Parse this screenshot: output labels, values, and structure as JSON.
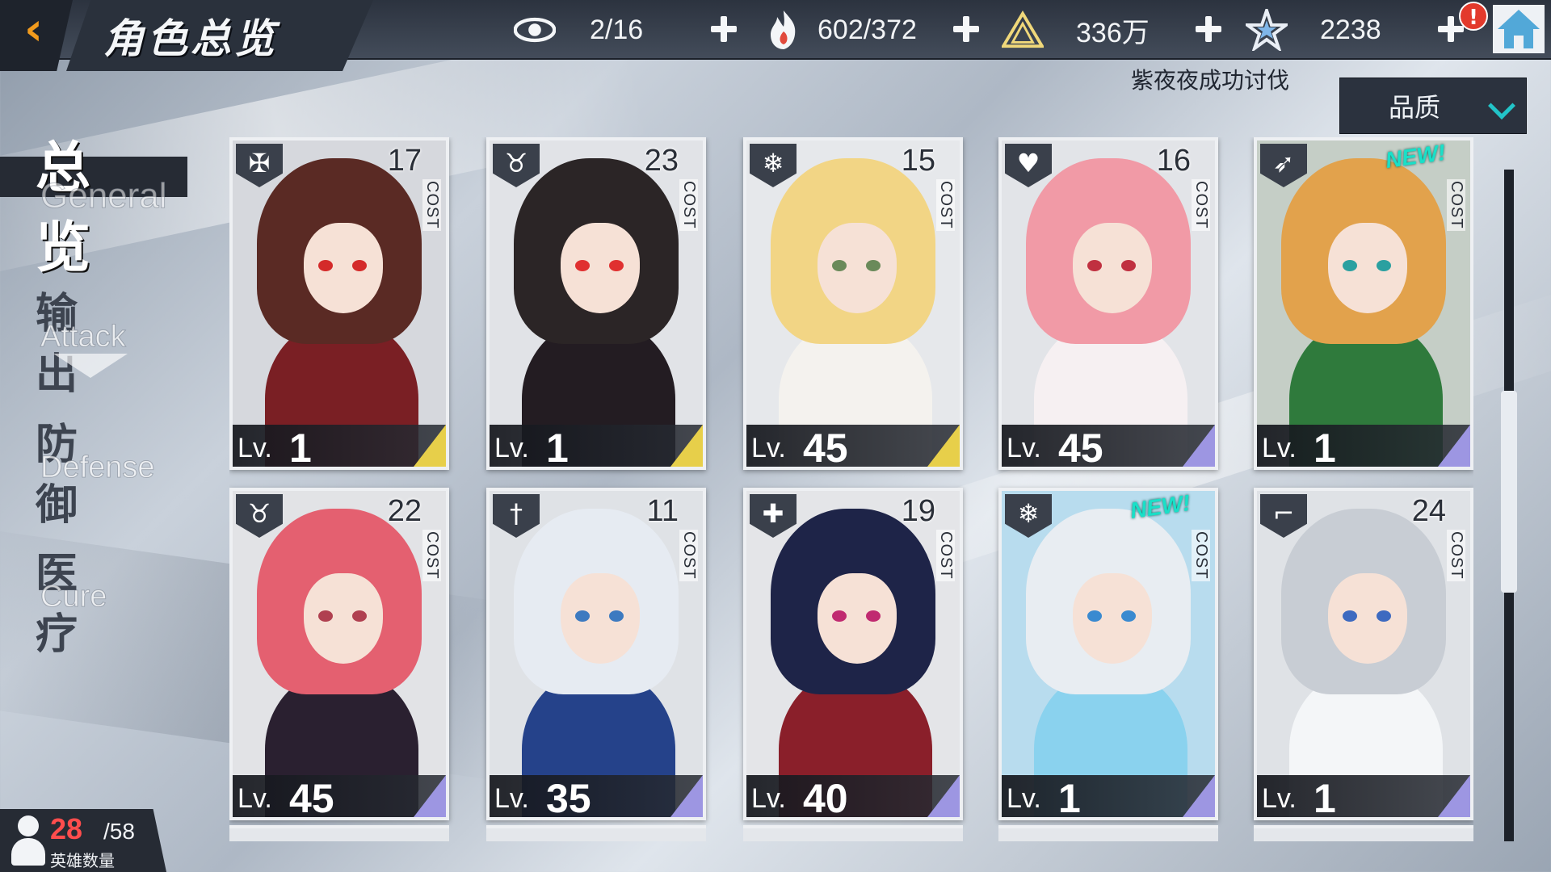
{
  "header": {
    "title": "角色总览",
    "resources": [
      {
        "icon": "eye-icon",
        "value": "2/16"
      },
      {
        "icon": "flame-hand-icon",
        "value": "602/372"
      },
      {
        "icon": "pyramid-icon",
        "value": "336万"
      },
      {
        "icon": "star-icon",
        "value": "2238"
      }
    ],
    "alert_badge": "!"
  },
  "ticker": {
    "text": "紫夜夜成功讨伐"
  },
  "sort": {
    "label": "品质"
  },
  "categories": [
    {
      "cn": "总览",
      "en": "General",
      "active": true
    },
    {
      "cn": "输出",
      "en": "Attack",
      "active": false
    },
    {
      "cn": "防御",
      "en": "Defense",
      "active": false
    },
    {
      "cn": "医疗",
      "en": "Cure",
      "active": false
    }
  ],
  "hero_count": {
    "current": "28",
    "max": "/58",
    "label": "英雄数量"
  },
  "cost_label": "COST",
  "level_prefix": "Lv.",
  "cards": [
    {
      "class_icon": "cross-wings-icon",
      "cost": "17",
      "new_badge": "",
      "level": "1",
      "rarity_color": "#e7cf4a",
      "hair": "#5a2a24",
      "outfit": "#7a1f24",
      "bg": "#d6d8dd",
      "eye": "#d42a2a"
    },
    {
      "class_icon": "horned-skull-icon",
      "cost": "23",
      "new_badge": "",
      "level": "1",
      "rarity_color": "#e7cf4a",
      "hair": "#2b2526",
      "outfit": "#231c22",
      "bg": "#e1e3e7",
      "eye": "#e03030"
    },
    {
      "class_icon": "snowflake-icon",
      "cost": "15",
      "new_badge": "",
      "level": "45",
      "rarity_color": "#e7cf4a",
      "hair": "#f2d585",
      "outfit": "#f4f2ee",
      "bg": "#e6e8eb",
      "eye": "#6a8a5a"
    },
    {
      "class_icon": "heart-shield-icon",
      "cost": "16",
      "new_badge": "",
      "level": "45",
      "rarity_color": "#9d96e2",
      "hair": "#f19aa6",
      "outfit": "#f6f0f2",
      "bg": "#e2e4e8",
      "eye": "#c03040"
    },
    {
      "class_icon": "bow-icon",
      "cost": "",
      "new_badge": "NEW!",
      "level": "1",
      "rarity_color": "#9d96e2",
      "hair": "#e2a24c",
      "outfit": "#2f7a3c",
      "bg": "#c5cec6",
      "eye": "#2aa0a0"
    },
    {
      "class_icon": "horned-skull-icon",
      "cost": "22",
      "new_badge": "",
      "level": "45",
      "rarity_color": "#9d96e2",
      "hair": "#e46070",
      "outfit": "#2a2030",
      "bg": "#e2e3e6",
      "eye": "#b04050"
    },
    {
      "class_icon": "sword-icon",
      "cost": "11",
      "new_badge": "",
      "level": "35",
      "rarity_color": "#9d96e2",
      "hair": "#e6ebf2",
      "outfit": "#25428a",
      "bg": "#dfe2e6",
      "eye": "#3d7ac0"
    },
    {
      "class_icon": "shield-cross-icon",
      "cost": "19",
      "new_badge": "",
      "level": "40",
      "rarity_color": "#9d96e2",
      "hair": "#1e2448",
      "outfit": "#8a1f2a",
      "bg": "#e4e5e8",
      "eye": "#c02a70"
    },
    {
      "class_icon": "snowflake-icon",
      "cost": "",
      "new_badge": "NEW!",
      "level": "1",
      "rarity_color": "#9d96e2",
      "hair": "#e8edf2",
      "outfit": "#8ad2ee",
      "bg": "#b8dcee",
      "eye": "#3a8ad0"
    },
    {
      "class_icon": "gun-icon",
      "cost": "24",
      "new_badge": "",
      "level": "1",
      "rarity_color": "#9d96e2",
      "hair": "#c8cdd4",
      "outfit": "#f4f6f8",
      "bg": "#dfe2e6",
      "eye": "#3d6ac0"
    }
  ]
}
